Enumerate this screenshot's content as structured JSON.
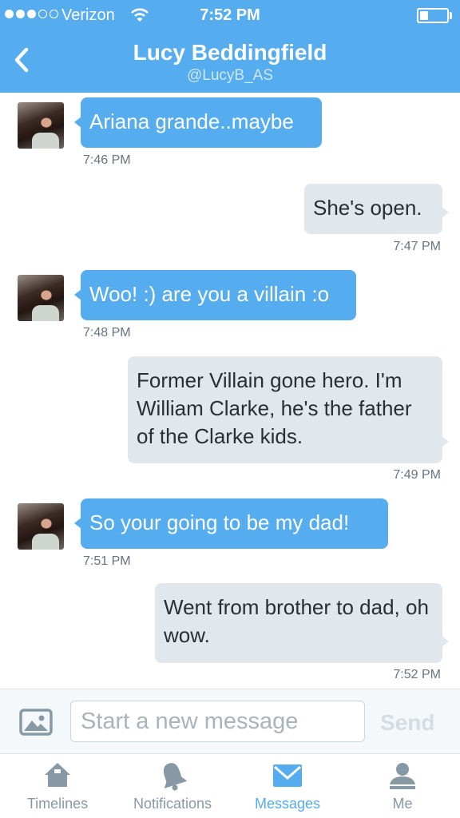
{
  "status_bar": {
    "carrier": "Verizon",
    "time": "7:52 PM",
    "signal_bars_filled": 3,
    "signal_bars_total": 5,
    "battery_level": 0.3
  },
  "header": {
    "back_icon": "chevron-left-icon",
    "name": "Lucy Beddingfield",
    "handle": "@LucyB_AS"
  },
  "messages": [
    {
      "direction": "incoming",
      "text": "Ariana grande..maybe",
      "time": "7:46 PM"
    },
    {
      "direction": "outgoing",
      "text": "She's open.",
      "time": "7:47 PM"
    },
    {
      "direction": "incoming",
      "text": "Woo! :) are you a villain :o",
      "time": "7:48 PM"
    },
    {
      "direction": "outgoing",
      "text": "Former Villain gone hero. I'm William Clarke, he's the father of the Clarke kids.",
      "time": "7:49 PM"
    },
    {
      "direction": "incoming",
      "text": "So your going to be my dad!",
      "time": "7:51 PM"
    },
    {
      "direction": "outgoing",
      "text": "Went from brother to dad, oh wow.",
      "time": "7:52 PM"
    }
  ],
  "composer": {
    "photo_icon": "photo-icon",
    "placeholder": "Start a new message",
    "value": "",
    "send_label": "Send"
  },
  "tabs": [
    {
      "label": "Timelines",
      "icon": "home-icon",
      "active": false
    },
    {
      "label": "Notifications",
      "icon": "bell-icon",
      "active": false
    },
    {
      "label": "Messages",
      "icon": "envelope-icon",
      "active": true
    },
    {
      "label": "Me",
      "icon": "person-icon",
      "active": false
    }
  ],
  "colors": {
    "brand": "#55acee",
    "incoming_bubble": "#55acee",
    "outgoing_bubble": "#e1e8ed",
    "inactive_tab": "#8899a6"
  }
}
